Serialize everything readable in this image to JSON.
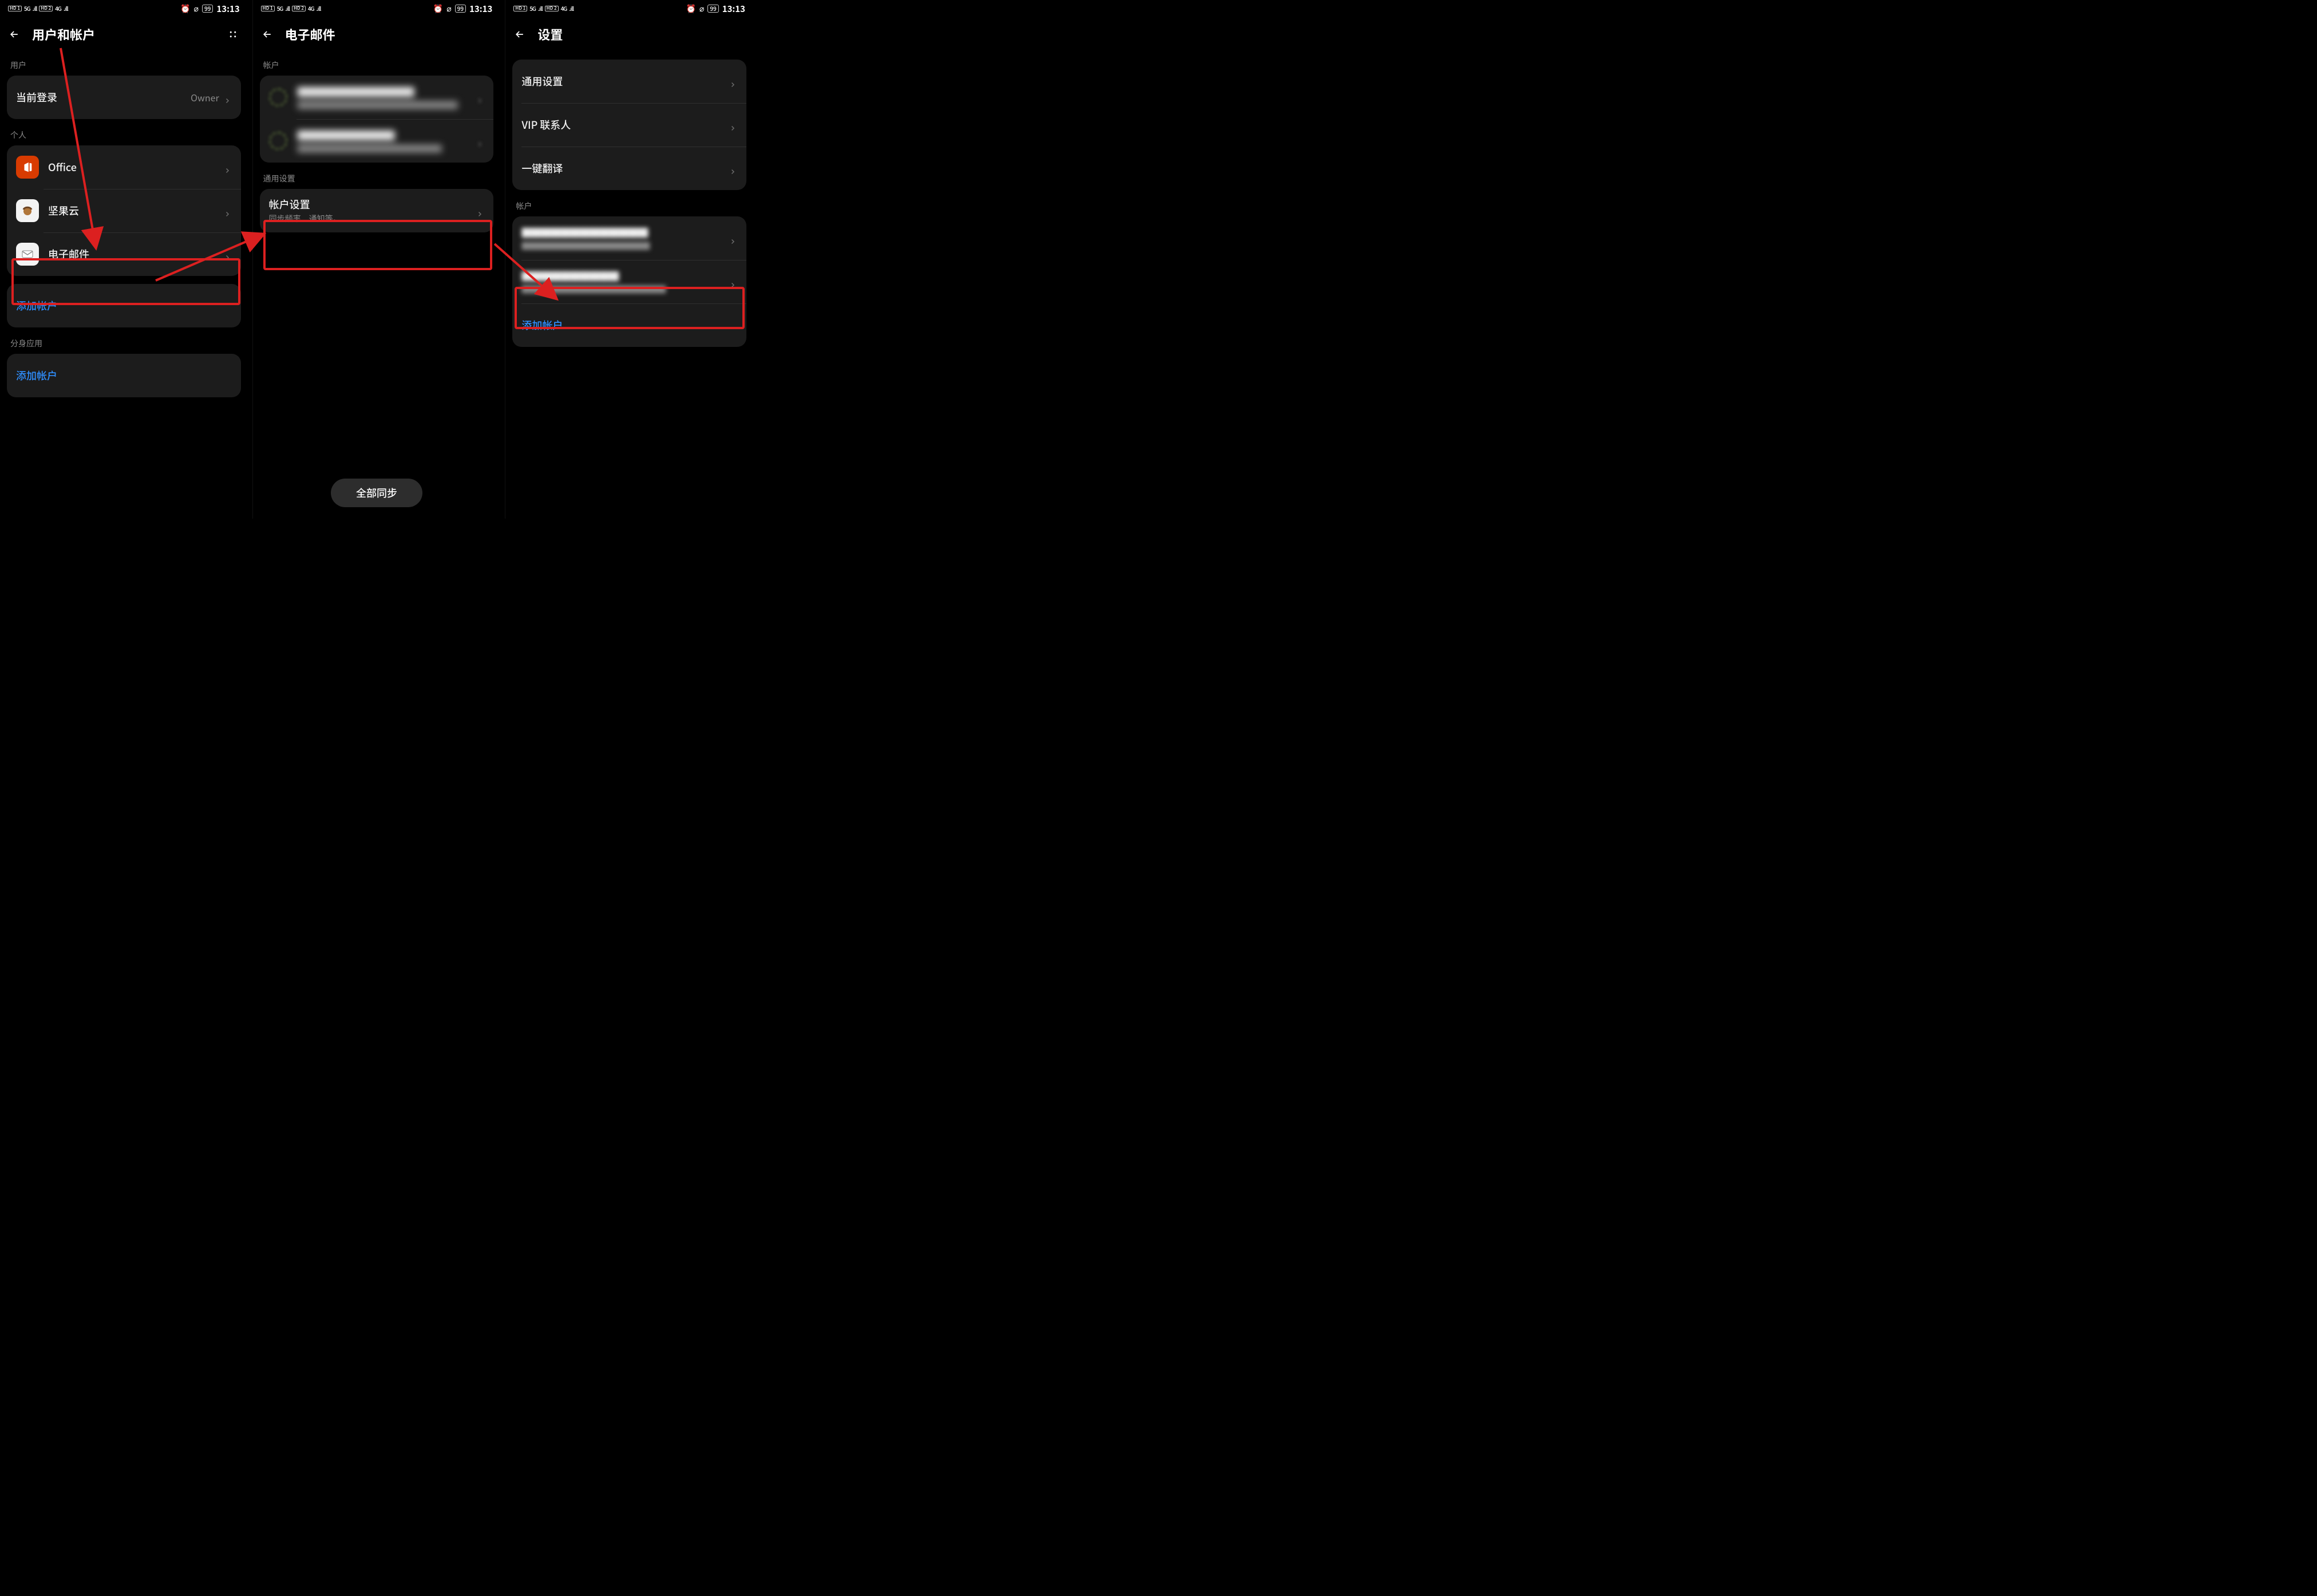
{
  "status": {
    "hd1": "HD 1",
    "hd2": "HD 2",
    "sig1": "5G",
    "sig2": "4G",
    "batt": "99",
    "time": "13:13"
  },
  "screen1": {
    "title": "用户和帐户",
    "section_user": "用户",
    "current_login_label": "当前登录",
    "current_login_value": "Owner",
    "section_personal": "个人",
    "items": {
      "office": "Office",
      "nutcloud": "坚果云",
      "email": "电子邮件"
    },
    "add_account": "添加帐户",
    "section_clone": "分身应用",
    "add_account2": "添加帐户"
  },
  "screen2": {
    "title": "电子邮件",
    "section_accounts": "帐户",
    "acc1_line1": "████████████",
    "acc1_line2": "████████████████████",
    "acc2_line1": "██████████",
    "acc2_line2": "██████████████████",
    "section_general": "通用设置",
    "acct_settings_label": "帐户设置",
    "acct_settings_sub": "同步频率、通知等。",
    "sync_all": "全部同步"
  },
  "screen3": {
    "title": "设置",
    "general": "通用设置",
    "vip": "VIP 联系人",
    "translate": "一键翻译",
    "section_accounts": "帐户",
    "acc1_line1": "█████████████",
    "acc1_line2": "████████████████",
    "acc2_line1": "██████████",
    "acc2_line2": "██████████████████",
    "add_account": "添加帐户"
  }
}
